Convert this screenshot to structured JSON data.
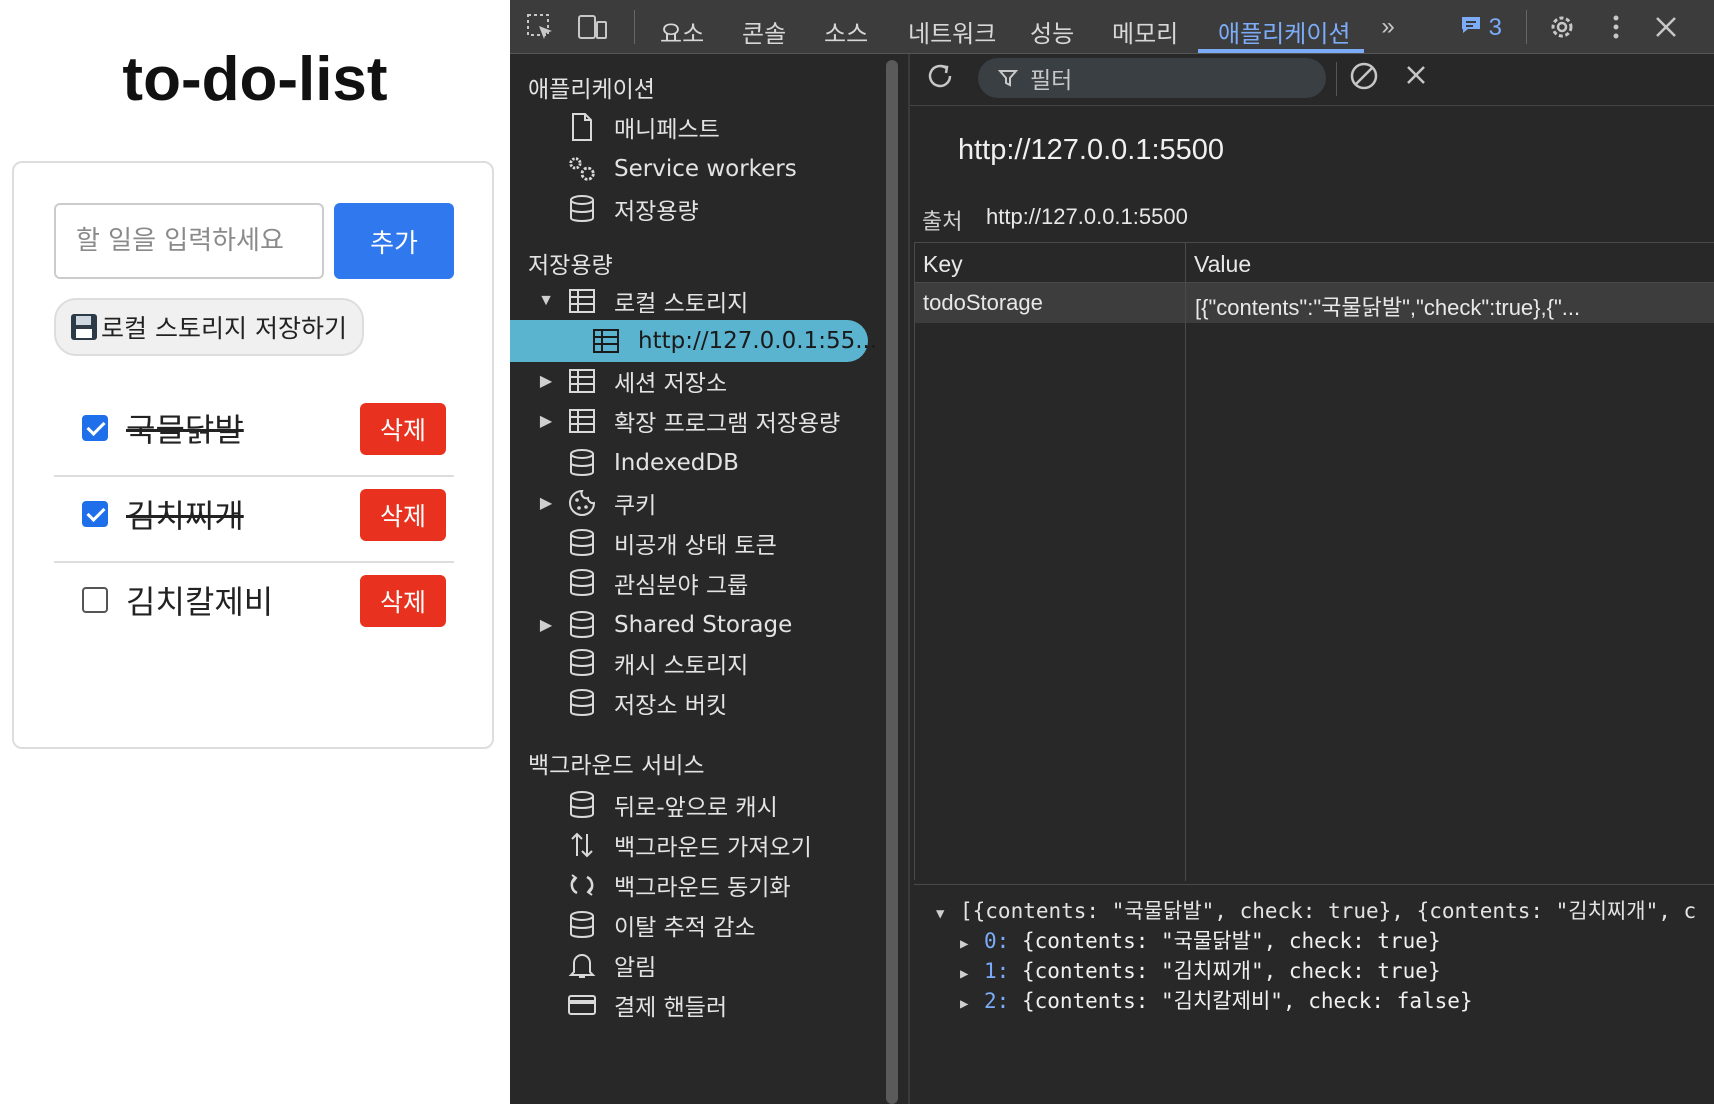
{
  "todo": {
    "title": "to-do-list",
    "input_placeholder": "할 일을 입력하세요",
    "add_label": "추가",
    "save_label": "로컬 스토리지 저장하기",
    "items": [
      {
        "text": "국물닭발",
        "checked": true,
        "delete_label": "삭제"
      },
      {
        "text": "김치찌개",
        "checked": true,
        "delete_label": "삭제"
      },
      {
        "text": "김치칼제비",
        "checked": false,
        "delete_label": "삭제"
      }
    ]
  },
  "devtools": {
    "tabs": [
      "요소",
      "콘솔",
      "소스",
      "네트워크",
      "성능",
      "메모리",
      "애플리케이션"
    ],
    "active_tab": "애플리케이션",
    "issues_count": "3",
    "sidebar": {
      "section_application": "애플리케이션",
      "application_items": [
        "매니페스트",
        "Service workers",
        "저장용량"
      ],
      "section_storage": "저장용량",
      "storage_items": {
        "local_storage": "로컬 스토리지",
        "local_origin": "http://127.0.0.1:55...",
        "session_storage": "세션 저장소",
        "extension_storage": "확장 프로그램 저장용량",
        "indexeddb": "IndexedDB",
        "cookies": "쿠키",
        "private_state_tokens": "비공개 상태 토큰",
        "interest_groups": "관심분야 그룹",
        "shared_storage": "Shared Storage",
        "cache_storage": "캐시 스토리지",
        "storage_buckets": "저장소 버킷"
      },
      "section_background": "백그라운드 서비스",
      "background_items": [
        "뒤로-앞으로 캐시",
        "백그라운드 가져오기",
        "백그라운드 동기화",
        "이탈 추적 감소",
        "알림",
        "결제 핸들러"
      ]
    },
    "filter_placeholder": "필터",
    "origin_title": "http://127.0.0.1:5500",
    "origin_label": "출처",
    "origin_value": "http://127.0.0.1:5500",
    "table": {
      "headers": [
        "Key",
        "Value"
      ],
      "rows": [
        {
          "key": "todoStorage",
          "value": "[{\"contents\":\"국물닭발\",\"check\":true},{\"..."
        }
      ]
    },
    "preview": {
      "summary": "[{contents: \"국물닭발\", check: true}, {contents: \"김치찌개\", c",
      "entries": [
        {
          "index": "0:",
          "body": "{contents: \"국물닭발\", check: true}"
        },
        {
          "index": "1:",
          "body": "{contents: \"김치찌개\", check: true}"
        },
        {
          "index": "2:",
          "body": "{contents: \"김치칼제비\", check: false}"
        }
      ]
    }
  }
}
